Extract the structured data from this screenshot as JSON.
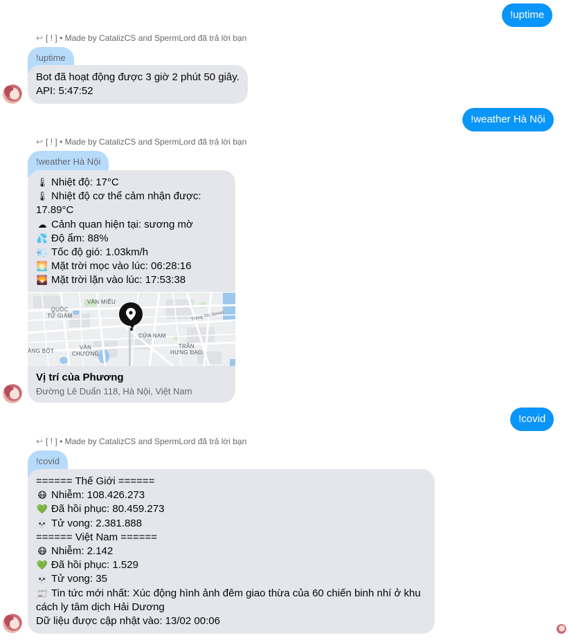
{
  "messages": {
    "out1": "!uptime",
    "reply_meta1": "[ ! ] • Made by CatalizCS and SpermLord đã trả lời bạn",
    "quote1": "!uptime",
    "uptime_line1": "Bot đã hoạt động được 3 giờ 2 phút 50 giây.",
    "uptime_line2": "API: 5:47:52",
    "out2": "!weather Hà Nội",
    "reply_meta2": "[ ! ] • Made by CatalizCS and SpermLord đã trả lời bạn",
    "quote2": "!weather Hà Nội",
    "weather": [
      {
        "icon": "thermometer-icon",
        "glyph": "🌡",
        "text": "Nhiệt độ: 17°C"
      },
      {
        "icon": "thermometer-icon",
        "glyph": "🌡",
        "text": "Nhiệt độ cơ thể cảm nhận được:"
      },
      {
        "icon": "",
        "glyph": "",
        "text": "17.89°C"
      },
      {
        "icon": "cloud-icon",
        "glyph": "☁",
        "text": "Cảnh quan hiện tại: sương mờ"
      },
      {
        "icon": "droplets-icon",
        "glyph": "💦",
        "text": "Độ ẩm: 88%"
      },
      {
        "icon": "wind-icon",
        "glyph": "💨",
        "text": "Tốc độ gió: 1.03km/h"
      },
      {
        "icon": "sunrise-icon",
        "glyph": "🌅",
        "text": "Mặt trời mọc vào lúc: 06:28:16"
      },
      {
        "icon": "sunset-icon",
        "glyph": "🌄",
        "text": "Mặt trời lặn vào lúc: 17:53:38"
      }
    ],
    "map_labels": {
      "van_mieu": "VĂN MIẾU",
      "quoc_tu_giam": "QUỐC\nTỬ GIÁM",
      "cua_nam": "CỬA NAM",
      "lang_bot": "ÀNG BỘT",
      "van_chuong": "VĂN\nCHƯƠNG",
      "tran_hung_dao": "TRẦN\nHƯNG ĐẠO",
      "trang_thi": "Tràng Thi Street"
    },
    "location_title": "Vị trí của Phương",
    "location_address": "Đường Lê Duẩn 118, Hà Nội, Việt Nam",
    "out3": "!covid",
    "reply_meta3": "[ ! ] • Made by CatalizCS and SpermLord đã trả lời bạn",
    "quote3": "!covid",
    "covid": [
      {
        "icon": "",
        "glyph": "",
        "text": "====== Thế Giới ======"
      },
      {
        "icon": "sick-face-icon",
        "glyph": "😷",
        "text": "Nhiễm: 108.426.273"
      },
      {
        "icon": "green-heart-icon",
        "glyph": "💚",
        "text": "Đã hồi phục: 80.459.273"
      },
      {
        "icon": "skull-icon",
        "glyph": "💀",
        "text": "Tử vong: 2.381.888"
      },
      {
        "icon": "",
        "glyph": "",
        "text": "====== Việt Nam ======"
      },
      {
        "icon": "sick-face-icon",
        "glyph": "😷",
        "text": "Nhiễm: 2.142"
      },
      {
        "icon": "green-heart-icon",
        "glyph": "💚",
        "text": "Đã hồi phục: 1.529"
      },
      {
        "icon": "skull-icon",
        "glyph": "💀",
        "text": "Tử vong: 35"
      },
      {
        "icon": "newspaper-icon",
        "glyph": "📰",
        "text": "Tin tức mới nhất: Xúc động hình ảnh đêm giao thừa của 60 chiến binh nhí ở khu"
      },
      {
        "icon": "",
        "glyph": "",
        "text": "cách ly tâm dịch Hải Dương"
      },
      {
        "icon": "",
        "glyph": "",
        "text": "Dữ liệu được cập nhật vào: 13/02 00:06"
      }
    ]
  },
  "colors": {
    "outgoing": "#0a95f9",
    "incoming": "#e4e6eb",
    "quote": "#cfe3f7"
  }
}
